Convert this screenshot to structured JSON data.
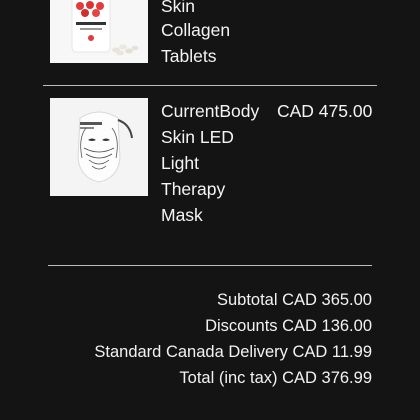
{
  "cart": {
    "items": [
      {
        "name_lines": [
          "Skin",
          "Collagen",
          "Tablets"
        ],
        "price": "",
        "image_icon": "collagen-bottle-image"
      },
      {
        "name_lines": [
          "CurrentBody",
          "Skin LED",
          "Light",
          "Therapy",
          "Mask"
        ],
        "price": "CAD 475.00",
        "image_icon": "led-mask-image"
      }
    ]
  },
  "summary": {
    "subtotal": "Subtotal CAD 365.00",
    "discounts": "Discounts CAD 136.00",
    "delivery": "Standard Canada Delivery CAD 11.99",
    "total": "Total (inc tax) CAD 376.99"
  },
  "colors": {
    "background": "#141414",
    "text": "#f2f2f2",
    "divider": "#bdbdbd",
    "thumb_background": "#f7f7f7",
    "bottle_cap": "#e23b3b"
  }
}
